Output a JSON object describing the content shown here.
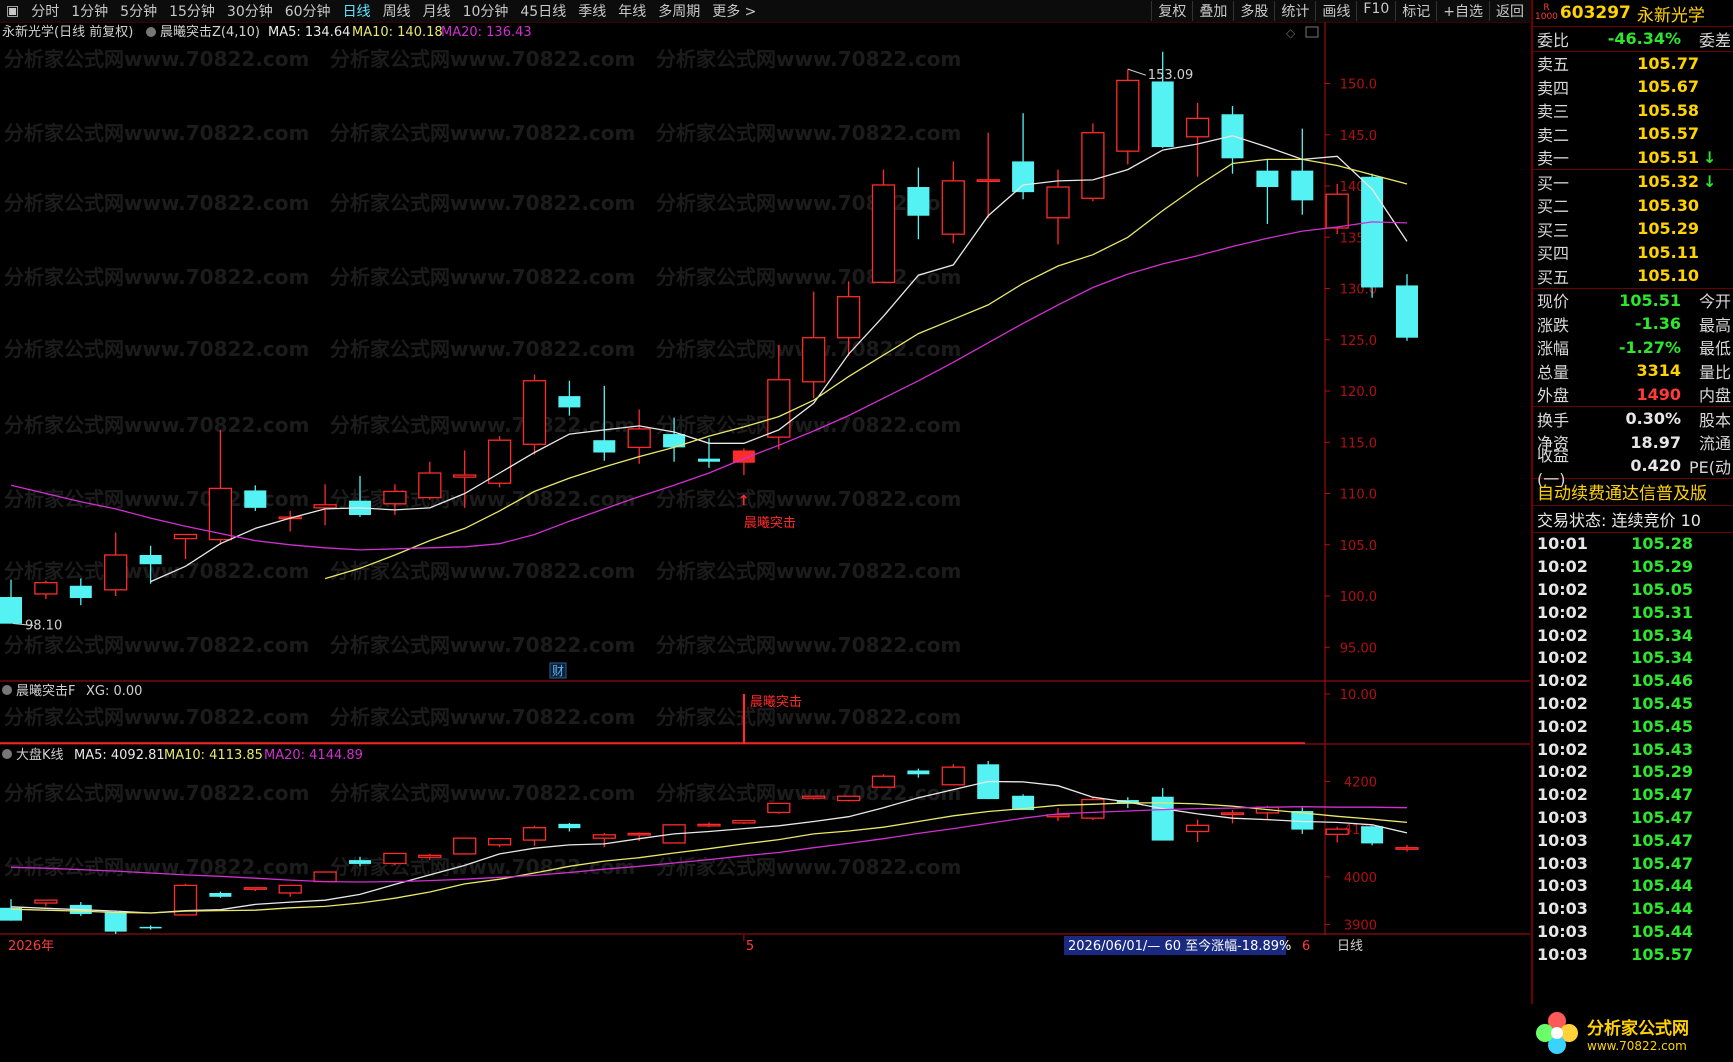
{
  "topbar": {
    "period_tabs": [
      "分时",
      "1分钟",
      "5分钟",
      "15分钟",
      "30分钟",
      "60分钟",
      "日线",
      "周线",
      "月线",
      "10分钟",
      "45日线",
      "季线",
      "年线",
      "多周期",
      "更多 >"
    ],
    "active_tab": "日线",
    "tools": [
      "复权",
      "叠加",
      "多股",
      "统计",
      "画线",
      "F10",
      "标记",
      "+自选",
      "返回"
    ]
  },
  "main_chart": {
    "title": "永新光学(日线 前复权)",
    "indicator_name": "晨曦突击Z(4,10)",
    "ma5_label": "MA5: 134.64",
    "ma10_label": "MA10: 140.18",
    "ma20_label": "MA20: 136.43",
    "high_marker": "153.09",
    "low_marker": "98.10",
    "signal_label": "晨曦突击",
    "fin_badge": "财",
    "watermark": "分析家公式网www.70822.com"
  },
  "sub_indicator": {
    "name": "晨曦突击F",
    "xg_label": "XG: 0.00",
    "signal_label": "晨曦突击",
    "axis_tick": "10.00"
  },
  "index_chart": {
    "name": "大盘K线",
    "ma5_label": "MA5: 4092.81",
    "ma10_label": "MA10: 4113.85",
    "ma20_label": "MA20: 4144.89"
  },
  "bottom_axis": {
    "year_label": "2026年",
    "month_label_5": "5",
    "month_label_6": "6",
    "range_note": "2026/06/01/— 60 至今涨幅-18.89%",
    "period_label": "日线"
  },
  "chart_data": [
    {
      "type": "candlestick",
      "title": "永新光学(日线 前复权)",
      "ylim": [
        92,
        156
      ],
      "y_ticks": [
        95,
        100,
        105,
        110,
        115,
        120,
        125,
        130,
        135,
        140,
        145,
        150
      ],
      "y_tick_labels": [
        "95.00",
        "100.0",
        "105.0",
        "110.0",
        "115.0",
        "120.0",
        "125.0",
        "130.0",
        "135.0",
        "140.0",
        "145.0",
        "150.0"
      ],
      "candles": [
        {
          "o": 99.9,
          "h": 101.6,
          "l": 98.1,
          "c": 97.3
        },
        {
          "o": 100.2,
          "h": 101.5,
          "l": 99.7,
          "c": 101.3
        },
        {
          "o": 101.0,
          "h": 101.7,
          "l": 99.1,
          "c": 99.8
        },
        {
          "o": 100.6,
          "h": 106.2,
          "l": 100.0,
          "c": 104.0
        },
        {
          "o": 104.0,
          "h": 104.9,
          "l": 101.2,
          "c": 103.1
        },
        {
          "o": 105.6,
          "h": 106.0,
          "l": 103.6,
          "c": 106.0
        },
        {
          "o": 105.5,
          "h": 116.2,
          "l": 105.0,
          "c": 110.5
        },
        {
          "o": 110.3,
          "h": 110.8,
          "l": 108.3,
          "c": 108.6
        },
        {
          "o": 107.7,
          "h": 108.3,
          "l": 106.3,
          "c": 107.7
        },
        {
          "o": 108.6,
          "h": 110.9,
          "l": 106.9,
          "c": 108.9
        },
        {
          "o": 109.3,
          "h": 111.7,
          "l": 107.7,
          "c": 107.9
        },
        {
          "o": 109.0,
          "h": 110.9,
          "l": 107.9,
          "c": 110.2
        },
        {
          "o": 109.6,
          "h": 113.1,
          "l": 109.4,
          "c": 112.0
        },
        {
          "o": 111.6,
          "h": 114.2,
          "l": 108.6,
          "c": 111.8
        },
        {
          "o": 111.0,
          "h": 115.6,
          "l": 110.6,
          "c": 115.2
        },
        {
          "o": 114.8,
          "h": 121.6,
          "l": 113.8,
          "c": 121.0
        },
        {
          "o": 119.5,
          "h": 121.0,
          "l": 117.6,
          "c": 118.4
        },
        {
          "o": 115.2,
          "h": 120.5,
          "l": 113.2,
          "c": 114.0
        },
        {
          "o": 114.5,
          "h": 118.2,
          "l": 112.9,
          "c": 116.3
        },
        {
          "o": 115.8,
          "h": 117.4,
          "l": 113.1,
          "c": 114.5
        },
        {
          "o": 113.4,
          "h": 115.4,
          "l": 112.5,
          "c": 113.1
        },
        {
          "o": 113.0,
          "h": 114.4,
          "l": 111.8,
          "c": 114.2
        },
        {
          "o": 115.5,
          "h": 124.5,
          "l": 114.3,
          "c": 121.1
        },
        {
          "o": 120.9,
          "h": 129.7,
          "l": 119.3,
          "c": 125.2
        },
        {
          "o": 125.2,
          "h": 130.7,
          "l": 123.4,
          "c": 129.2
        },
        {
          "o": 130.6,
          "h": 141.6,
          "l": 130.6,
          "c": 140.1
        },
        {
          "o": 139.9,
          "h": 141.8,
          "l": 134.8,
          "c": 137.1
        },
        {
          "o": 135.3,
          "h": 142.4,
          "l": 134.4,
          "c": 140.5
        },
        {
          "o": 140.6,
          "h": 145.2,
          "l": 136.9,
          "c": 140.6
        },
        {
          "o": 142.4,
          "h": 147.1,
          "l": 138.7,
          "c": 139.4
        },
        {
          "o": 136.9,
          "h": 141.6,
          "l": 134.3,
          "c": 139.9
        },
        {
          "o": 138.8,
          "h": 146.1,
          "l": 138.5,
          "c": 145.2
        },
        {
          "o": 143.4,
          "h": 151.4,
          "l": 142.1,
          "c": 150.3
        },
        {
          "o": 150.2,
          "h": 153.1,
          "l": 143.7,
          "c": 143.8
        },
        {
          "o": 144.8,
          "h": 148.1,
          "l": 140.9,
          "c": 146.6
        },
        {
          "o": 147.0,
          "h": 147.8,
          "l": 141.2,
          "c": 142.7
        },
        {
          "o": 141.5,
          "h": 142.6,
          "l": 136.3,
          "c": 139.9
        },
        {
          "o": 141.5,
          "h": 145.6,
          "l": 137.2,
          "c": 138.6
        },
        {
          "o": 135.9,
          "h": 140.2,
          "l": 135.3,
          "c": 139.2
        },
        {
          "o": 140.9,
          "h": 141.2,
          "l": 129.1,
          "c": 130.1
        },
        {
          "o": 130.3,
          "h": 131.4,
          "l": 124.9,
          "c": 125.2
        }
      ],
      "signal_candle_index": 21,
      "ma5": [
        null,
        null,
        null,
        null,
        101.4,
        102.9,
        105.1,
        106.6,
        107.6,
        108.5,
        108.6,
        108.4,
        108.6,
        110.0,
        112.0,
        114.0,
        115.8,
        116.2,
        116.6,
        116.0,
        114.9,
        114.9,
        116.2,
        118.8,
        123.6,
        127.3,
        131.3,
        132.3,
        137.1,
        140.1,
        140.5,
        140.6,
        141.6,
        143.5,
        144.1,
        144.9,
        143.8,
        142.6,
        142.9,
        139.7,
        134.6
      ],
      "ma10": [
        null,
        null,
        null,
        null,
        null,
        null,
        null,
        null,
        null,
        101.7,
        102.7,
        104.0,
        105.4,
        106.6,
        108.3,
        110.2,
        111.5,
        112.6,
        113.6,
        114.5,
        115.6,
        116.5,
        117.5,
        119.1,
        121.4,
        123.5,
        125.6,
        127.0,
        128.4,
        130.5,
        132.2,
        133.3,
        135.0,
        137.6,
        140.0,
        142.2,
        142.6,
        142.6,
        142.0,
        141.1,
        140.2
      ],
      "ma20": [
        110.8,
        110.0,
        109.2,
        108.5,
        107.6,
        106.8,
        106.1,
        105.4,
        105.0,
        104.7,
        104.5,
        104.6,
        104.7,
        104.8,
        105.1,
        106.0,
        107.3,
        108.5,
        109.7,
        110.8,
        112.0,
        113.4,
        114.7,
        116.1,
        117.6,
        119.3,
        121.0,
        122.8,
        124.7,
        126.6,
        128.4,
        130.1,
        131.4,
        132.4,
        133.2,
        134.1,
        134.9,
        135.6,
        136.0,
        136.5,
        136.4
      ]
    },
    {
      "type": "bar",
      "title": "晨曦突击F",
      "ylim": [
        0,
        12
      ],
      "y_ticks": [
        10
      ],
      "signal_index": 21,
      "signal_value": 10
    },
    {
      "type": "candlestick",
      "title": "大盘K线",
      "ylim": [
        3880,
        4245
      ],
      "y_ticks": [
        3900,
        4000,
        4100,
        4200
      ],
      "y_tick_labels": [
        "3900",
        "4000",
        "4100",
        "4200"
      ],
      "candles": [
        {
          "o": 3935,
          "h": 3953,
          "l": 3908,
          "c": 3908
        },
        {
          "o": 3945,
          "h": 3952,
          "l": 3938,
          "c": 3951
        },
        {
          "o": 3941,
          "h": 3947,
          "l": 3918,
          "c": 3922
        },
        {
          "o": 3925,
          "h": 3928,
          "l": 3880,
          "c": 3885
        },
        {
          "o": 3895,
          "h": 3898,
          "l": 3889,
          "c": 3892
        },
        {
          "o": 3920,
          "h": 3985,
          "l": 3920,
          "c": 3982
        },
        {
          "o": 3966,
          "h": 3969,
          "l": 3956,
          "c": 3958
        },
        {
          "o": 3975,
          "h": 3978,
          "l": 3970,
          "c": 3977
        },
        {
          "o": 3966,
          "h": 3983,
          "l": 3958,
          "c": 3982
        },
        {
          "o": 3990,
          "h": 4011,
          "l": 3990,
          "c": 4010
        },
        {
          "o": 4035,
          "h": 4042,
          "l": 4022,
          "c": 4027
        },
        {
          "o": 4028,
          "h": 4050,
          "l": 4024,
          "c": 4049
        },
        {
          "o": 4041,
          "h": 4048,
          "l": 4035,
          "c": 4045
        },
        {
          "o": 4048,
          "h": 4082,
          "l": 4047,
          "c": 4081
        },
        {
          "o": 4067,
          "h": 4080,
          "l": 4062,
          "c": 4080
        },
        {
          "o": 4077,
          "h": 4107,
          "l": 4065,
          "c": 4103
        },
        {
          "o": 4111,
          "h": 4113,
          "l": 4095,
          "c": 4102
        },
        {
          "o": 4081,
          "h": 4092,
          "l": 4062,
          "c": 4088
        },
        {
          "o": 4089,
          "h": 4093,
          "l": 4075,
          "c": 4091
        },
        {
          "o": 4071,
          "h": 4110,
          "l": 4071,
          "c": 4109
        },
        {
          "o": 4107,
          "h": 4114,
          "l": 4104,
          "c": 4110
        },
        {
          "o": 4113,
          "h": 4118,
          "l": 4111,
          "c": 4118
        },
        {
          "o": 4135,
          "h": 4150,
          "l": 4132,
          "c": 4154
        },
        {
          "o": 4165,
          "h": 4170,
          "l": 4162,
          "c": 4169
        },
        {
          "o": 4160,
          "h": 4169,
          "l": 4158,
          "c": 4169
        },
        {
          "o": 4188,
          "h": 4215,
          "l": 4188,
          "c": 4211
        },
        {
          "o": 4223,
          "h": 4227,
          "l": 4208,
          "c": 4215
        },
        {
          "o": 4193,
          "h": 4236,
          "l": 4192,
          "c": 4230
        },
        {
          "o": 4236,
          "h": 4243,
          "l": 4163,
          "c": 4163
        },
        {
          "o": 4170,
          "h": 4173,
          "l": 4140,
          "c": 4140
        },
        {
          "o": 4126,
          "h": 4144,
          "l": 4117,
          "c": 4130
        },
        {
          "o": 4123,
          "h": 4168,
          "l": 4119,
          "c": 4162
        },
        {
          "o": 4161,
          "h": 4167,
          "l": 4144,
          "c": 4153
        },
        {
          "o": 4168,
          "h": 4186,
          "l": 4076,
          "c": 4076
        },
        {
          "o": 4095,
          "h": 4120,
          "l": 4073,
          "c": 4108
        },
        {
          "o": 4131,
          "h": 4140,
          "l": 4112,
          "c": 4134
        },
        {
          "o": 4134,
          "h": 4149,
          "l": 4120,
          "c": 4146
        },
        {
          "o": 4138,
          "h": 4145,
          "l": 4090,
          "c": 4099
        },
        {
          "o": 4089,
          "h": 4105,
          "l": 4072,
          "c": 4100
        },
        {
          "o": 4106,
          "h": 4107,
          "l": 4066,
          "c": 4070
        },
        {
          "o": 4059,
          "h": 4067,
          "l": 4053,
          "c": 4061
        }
      ],
      "ma5": [
        3937,
        3934,
        3931,
        3928,
        3924,
        3929,
        3931,
        3942,
        3947,
        3951,
        3963,
        3984,
        4004,
        4024,
        4048,
        4060,
        4067,
        4069,
        4080,
        4090,
        4095,
        4101,
        4107,
        4116,
        4126,
        4145,
        4166,
        4183,
        4200,
        4199,
        4191,
        4167,
        4157,
        4143,
        4132,
        4123,
        4120,
        4116,
        4114,
        4109,
        4092
      ],
      "ma10": [
        3932,
        3930,
        3928,
        3925,
        3924,
        3928,
        3929,
        3930,
        3935,
        3938,
        3945,
        3955,
        3968,
        3985,
        3995,
        4008,
        4022,
        4033,
        4040,
        4050,
        4059,
        4069,
        4078,
        4090,
        4096,
        4104,
        4116,
        4128,
        4137,
        4143,
        4150,
        4152,
        4155,
        4155,
        4153,
        4148,
        4141,
        4134,
        4127,
        4121,
        4114
      ],
      "ma20": [
        4020,
        4018,
        4015,
        4012,
        4008,
        4004,
        4001,
        3997,
        3993,
        3990,
        3989,
        3990,
        3992,
        3995,
        3999,
        4003,
        4009,
        4016,
        4022,
        4029,
        4036,
        4044,
        4051,
        4061,
        4070,
        4080,
        4091,
        4101,
        4112,
        4123,
        4132,
        4135,
        4138,
        4141,
        4143,
        4144,
        4146,
        4147,
        4146,
        4146,
        4145
      ]
    }
  ],
  "right_panel": {
    "code": "603297",
    "name": "永新光学",
    "r_badge": "R\n1000",
    "weibi": {
      "label": "委比",
      "value": "-46.34%",
      "label2": "委差"
    },
    "asks": [
      {
        "label": "卖五",
        "price": "105.77",
        "mark": ""
      },
      {
        "label": "卖四",
        "price": "105.67",
        "mark": ""
      },
      {
        "label": "卖三",
        "price": "105.58",
        "mark": ""
      },
      {
        "label": "卖二",
        "price": "105.57",
        "mark": ""
      },
      {
        "label": "卖一",
        "price": "105.51",
        "mark": "↓"
      }
    ],
    "bids": [
      {
        "label": "买一",
        "price": "105.32",
        "mark": "↓"
      },
      {
        "label": "买二",
        "price": "105.30",
        "mark": ""
      },
      {
        "label": "买三",
        "price": "105.29",
        "mark": ""
      },
      {
        "label": "买四",
        "price": "105.11",
        "mark": ""
      },
      {
        "label": "买五",
        "price": "105.10",
        "mark": ""
      }
    ],
    "stats1": [
      {
        "label": "现价",
        "value": "105.51",
        "label2": "今开",
        "cls": "green"
      },
      {
        "label": "涨跌",
        "value": "-1.36",
        "label2": "最高",
        "cls": "green"
      },
      {
        "label": "涨幅",
        "value": "-1.27%",
        "label2": "最低",
        "cls": "green"
      },
      {
        "label": "总量",
        "value": "3314",
        "label2": "量比",
        "cls": "yellow"
      },
      {
        "label": "外盘",
        "value": "1490",
        "label2": "内盘",
        "cls": "red"
      }
    ],
    "stats2": [
      {
        "label": "换手",
        "value": "0.30%",
        "label2": "股本",
        "cls": "white"
      },
      {
        "label": "净资",
        "value": "18.97",
        "label2": "流通",
        "cls": "white"
      },
      {
        "label": "收益(一)",
        "value": "0.420",
        "label2": "PE(动",
        "cls": "white"
      }
    ],
    "notice": "自动续费通达信普及版",
    "status": "交易状态: 连续竞价 10",
    "ticks": [
      {
        "t": "10:01",
        "p": "105.28"
      },
      {
        "t": "10:02",
        "p": "105.29"
      },
      {
        "t": "10:02",
        "p": "105.05"
      },
      {
        "t": "10:02",
        "p": "105.31"
      },
      {
        "t": "10:02",
        "p": "105.34"
      },
      {
        "t": "10:02",
        "p": "105.34"
      },
      {
        "t": "10:02",
        "p": "105.46"
      },
      {
        "t": "10:02",
        "p": "105.45"
      },
      {
        "t": "10:02",
        "p": "105.45"
      },
      {
        "t": "10:02",
        "p": "105.43"
      },
      {
        "t": "10:02",
        "p": "105.29"
      },
      {
        "t": "10:02",
        "p": "105.47"
      },
      {
        "t": "10:03",
        "p": "105.47"
      },
      {
        "t": "10:03",
        "p": "105.47"
      },
      {
        "t": "10:03",
        "p": "105.47"
      },
      {
        "t": "10:03",
        "p": "105.44"
      },
      {
        "t": "10:03",
        "p": "105.44"
      },
      {
        "t": "10:03",
        "p": "105.44"
      },
      {
        "t": "10:03",
        "p": "105.57"
      }
    ]
  },
  "logo": {
    "line1": "分析家公式网",
    "line2": "www.70822.com"
  },
  "colors": {
    "up": "#ff2a2a",
    "down": "#54f2f2",
    "ma5": "#e8e8e8",
    "ma10": "#e8e86a",
    "ma20": "#d030d0",
    "axis": "#b01010",
    "grid": "#7a0000"
  }
}
